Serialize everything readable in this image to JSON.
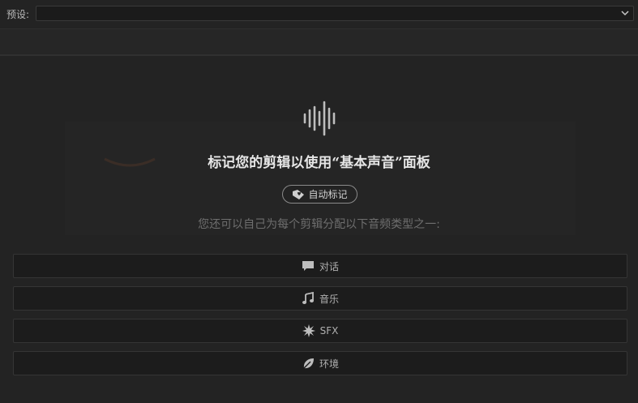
{
  "preset": {
    "label": "预设:",
    "value": ""
  },
  "panel": {
    "heading": "标记您的剪辑以使用“基本声音”面板",
    "auto_tag_label": "自动标记",
    "subtext": "您还可以自己为每个剪辑分配以下音频类型之一:"
  },
  "audio_types": [
    {
      "label": "对话",
      "icon": "speech-bubble-icon"
    },
    {
      "label": "音乐",
      "icon": "music-note-icon"
    },
    {
      "label": "SFX",
      "icon": "burst-icon"
    },
    {
      "label": "环境",
      "icon": "leaf-icon"
    }
  ],
  "colors": {
    "background": "#232323",
    "button_bg": "#1c1c1c",
    "heading": "#e6e6e6",
    "subtext": "#6e6e6e"
  }
}
